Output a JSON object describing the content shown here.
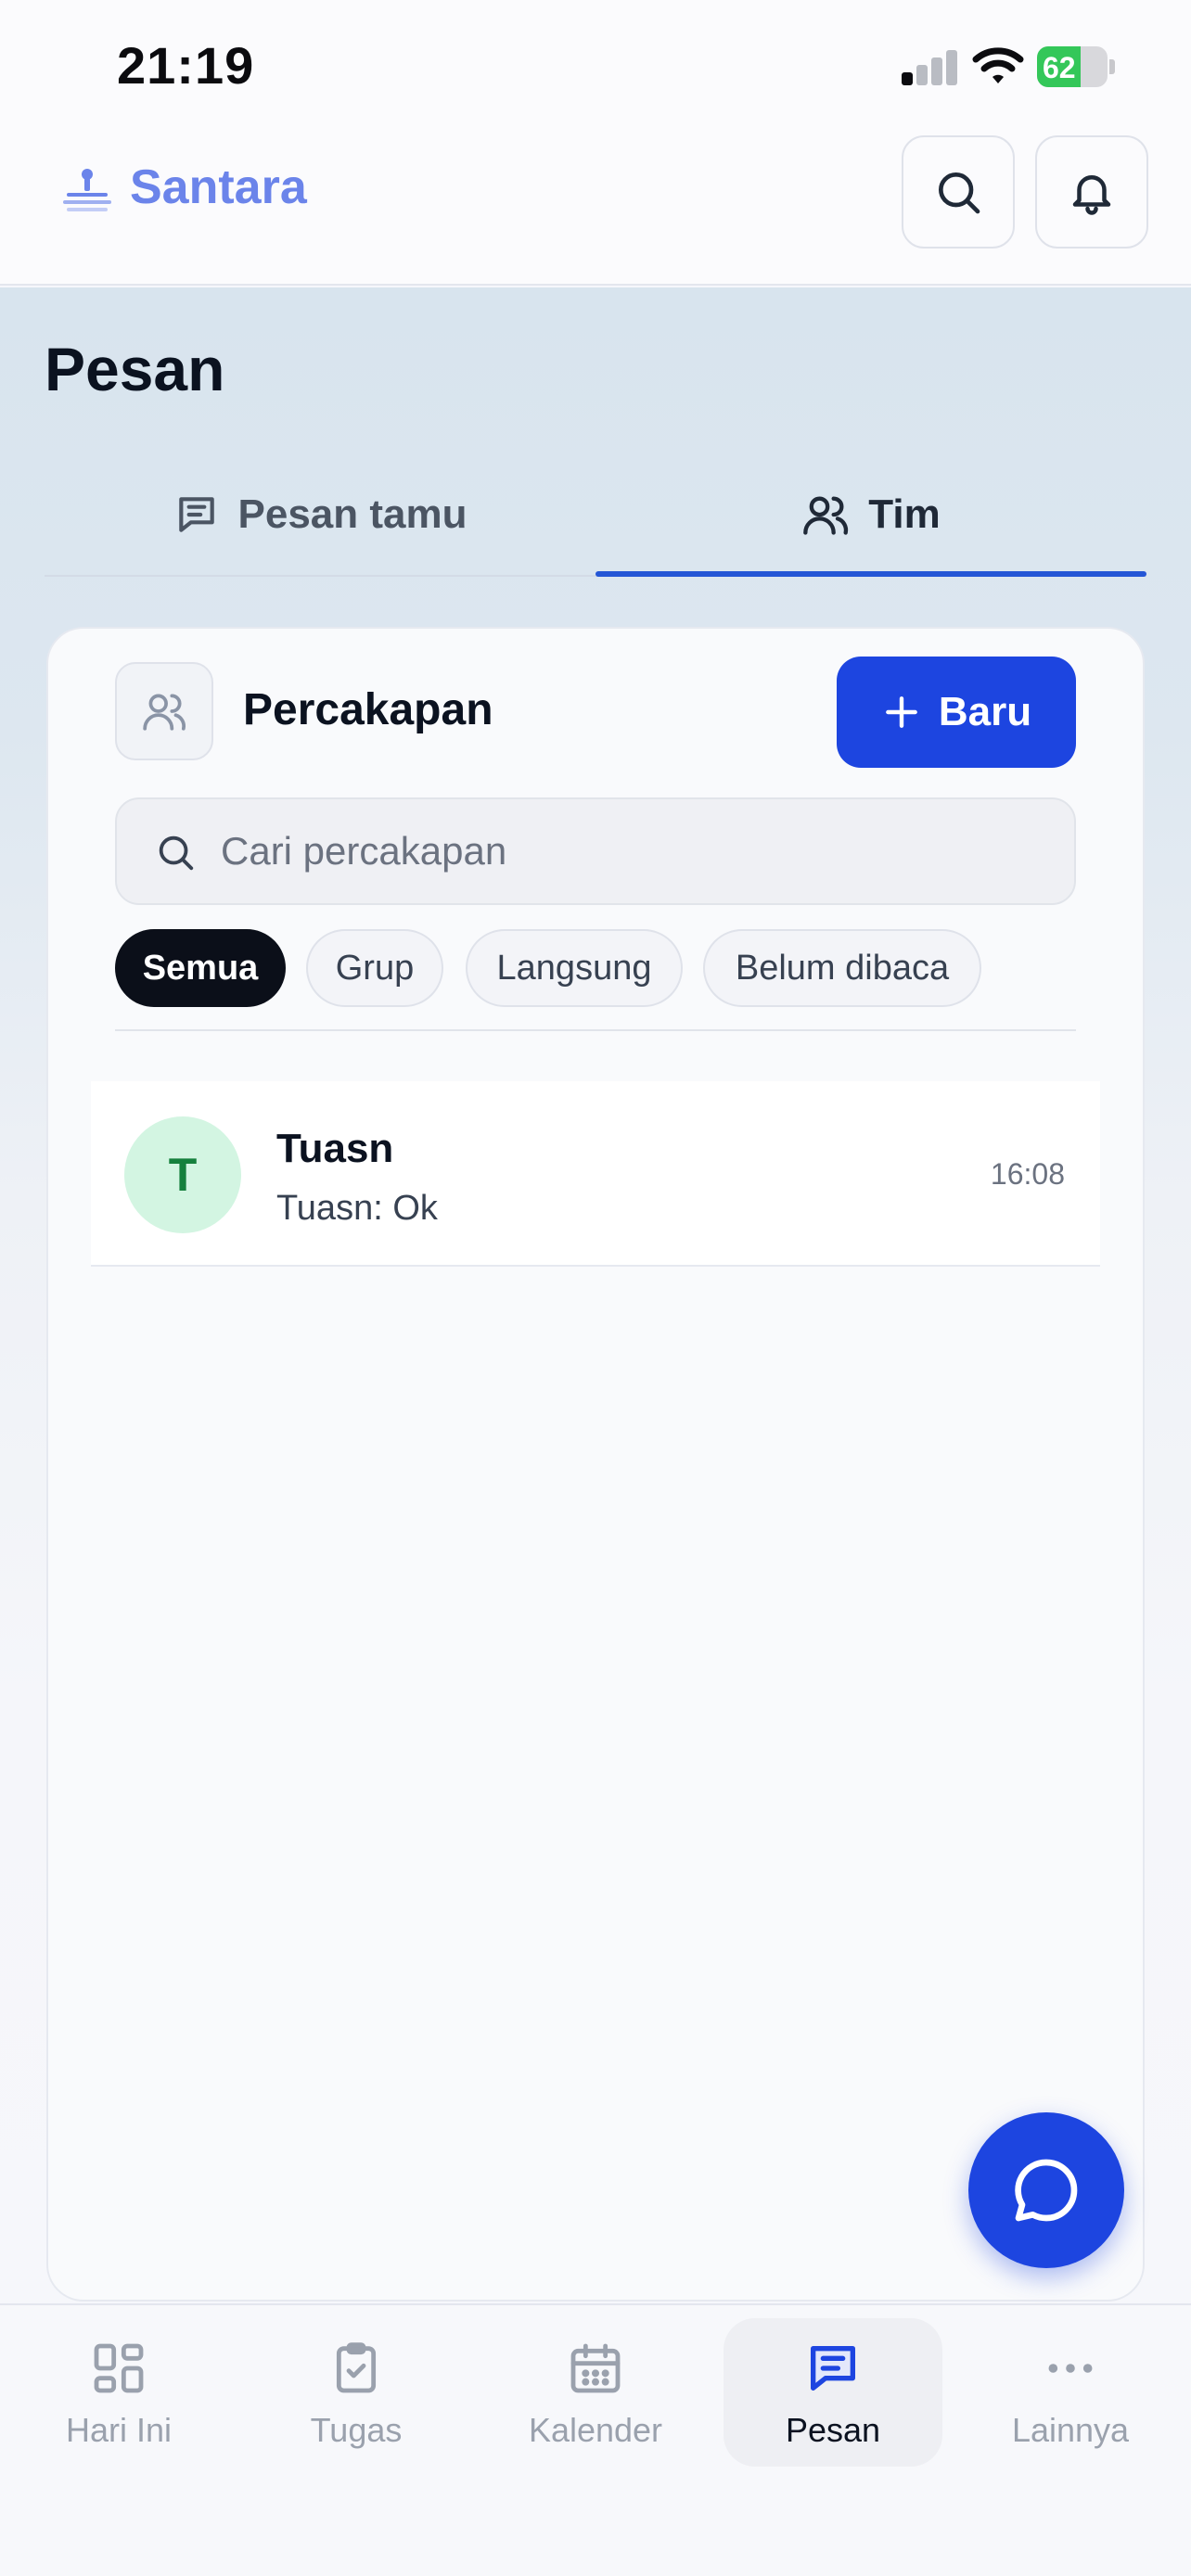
{
  "status_bar": {
    "time": "21:19",
    "battery_level": "62",
    "battery_fraction": 0.62
  },
  "header": {
    "brand": "Santara"
  },
  "page": {
    "title": "Pesan"
  },
  "tabs": [
    {
      "label": "Pesan tamu",
      "active": false
    },
    {
      "label": "Tim",
      "active": true
    }
  ],
  "conversations_panel": {
    "title": "Percakapan",
    "new_button": "Baru",
    "search_placeholder": "Cari percakapan",
    "filters": [
      {
        "label": "Semua",
        "active": true
      },
      {
        "label": "Grup",
        "active": false
      },
      {
        "label": "Langsung",
        "active": false
      },
      {
        "label": "Belum dibaca",
        "active": false
      }
    ],
    "items": [
      {
        "initial": "T",
        "name": "Tuasn",
        "preview": "Tuasn: Ok",
        "time": "16:08"
      }
    ]
  },
  "bottom_nav": [
    {
      "label": "Hari Ini",
      "icon": "dashboard-icon",
      "active": false
    },
    {
      "label": "Tugas",
      "icon": "clipboard-check-icon",
      "active": false
    },
    {
      "label": "Kalender",
      "icon": "calendar-icon",
      "active": false
    },
    {
      "label": "Pesan",
      "icon": "message-icon",
      "active": true
    },
    {
      "label": "Lainnya",
      "icon": "more-icon",
      "active": false
    }
  ],
  "colors": {
    "brand": "#6b84ea",
    "primary": "#1d45e0",
    "tab_active": "#2456d6",
    "battery": "#34c759",
    "avatar_bg": "#d3f5e2",
    "avatar_text": "#15803d"
  }
}
